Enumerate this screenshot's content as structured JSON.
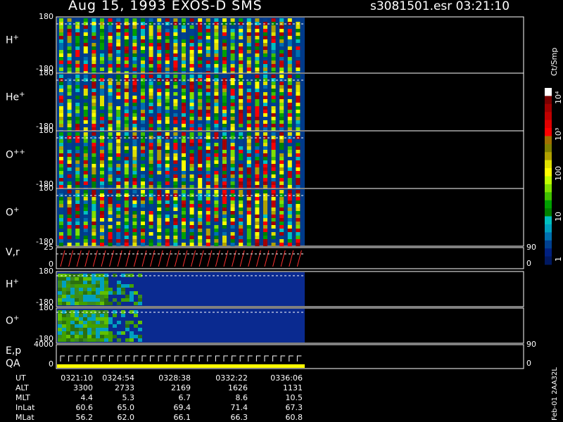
{
  "header": {
    "title": "Aug 15, 1993    EXOS-D SMS",
    "file_time": "s3081501.esr  03:21:10"
  },
  "panels": [
    {
      "label": "H",
      "charge": "+",
      "y_top": "180",
      "y_bottom": "-180",
      "kind": "spectrogram"
    },
    {
      "label": "He",
      "charge": "+",
      "y_top": "180",
      "y_bottom": "-180",
      "kind": "spectrogram"
    },
    {
      "label": "O",
      "charge": "++",
      "y_top": "180",
      "y_bottom": "-180",
      "kind": "spectrogram"
    },
    {
      "label": "O",
      "charge": "+",
      "y_top": "180",
      "y_bottom": "-180",
      "kind": "spectrogram"
    },
    {
      "label": "V,r",
      "charge": "",
      "y_top": "25",
      "y_bottom": "0",
      "right_top": "90",
      "right_bottom": "0",
      "kind": "line"
    },
    {
      "label": "H",
      "charge": "+",
      "y_top": "180",
      "y_bottom": "-180",
      "kind": "pitch"
    },
    {
      "label": "O",
      "charge": "+",
      "y_top": "180",
      "y_bottom": "-180",
      "kind": "pitch"
    },
    {
      "label": "E,p",
      "label2": "QA",
      "charge": "",
      "y_top": "4000",
      "y_bottom": "0",
      "right_top": "90",
      "right_bottom": "0",
      "kind": "energy"
    }
  ],
  "colorbar": {
    "unit": "Ct/Smp",
    "labels": [
      "10⁴",
      "10³",
      "100",
      "10",
      "1"
    ],
    "colors": [
      "#ffffff",
      "#7a0000",
      "#a00000",
      "#c00000",
      "#e00000",
      "#ff0000",
      "#a07000",
      "#808000",
      "#b0a000",
      "#e0e000",
      "#ffff00",
      "#c0ff00",
      "#80e000",
      "#40c000",
      "#00a000",
      "#008000",
      "#00c0c0",
      "#00a0c0",
      "#0070b0",
      "#004090",
      "#002080",
      "#001860"
    ]
  },
  "time_table": {
    "rows": [
      {
        "name": "UT",
        "values": [
          "0321:10",
          "0324:54",
          "0328:38",
          "0332:22",
          "0336:06"
        ]
      },
      {
        "name": "ALT",
        "values": [
          "3300",
          "2733",
          "2169",
          "1626",
          "1131"
        ]
      },
      {
        "name": "MLT",
        "values": [
          "4.4",
          "5.3",
          "6.7",
          "8.6",
          "10.5"
        ]
      },
      {
        "name": "InLat",
        "values": [
          "60.6",
          "65.0",
          "69.4",
          "71.4",
          "67.3"
        ]
      },
      {
        "name": "MLat",
        "values": [
          "56.2",
          "62.0",
          "66.1",
          "66.3",
          "60.8"
        ]
      }
    ]
  },
  "footer_id": "Feb-01 2AA32L",
  "chart_data": {
    "type": "heatmap",
    "title": "Aug 15, 1993    EXOS-D SMS",
    "x": [
      "0321:10",
      "0324:54",
      "0328:38",
      "0332:22",
      "0336:06"
    ],
    "xlabel": "UT",
    "series": [
      {
        "name": "H+",
        "ylim": [
          -180,
          180
        ]
      },
      {
        "name": "He+",
        "ylim": [
          -180,
          180
        ]
      },
      {
        "name": "O++",
        "ylim": [
          -180,
          180
        ]
      },
      {
        "name": "O+",
        "ylim": [
          -180,
          180
        ]
      },
      {
        "name": "V,r",
        "ylim": [
          0,
          25
        ]
      },
      {
        "name": "H+",
        "ylim": [
          -180,
          180
        ]
      },
      {
        "name": "O+",
        "ylim": [
          -180,
          180
        ]
      },
      {
        "name": "E,p",
        "ylim": [
          0,
          4000
        ]
      }
    ],
    "colorbar_unit": "Ct/Smp",
    "colorbar_ticks": [
      "1",
      "10",
      "100",
      "10³",
      "10⁴"
    ]
  }
}
